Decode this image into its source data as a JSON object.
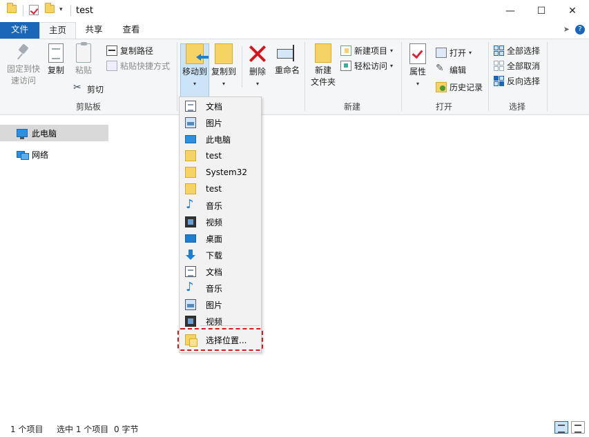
{
  "window": {
    "title": "test",
    "minimize_glyph": "—",
    "maximize_glyph": "☐",
    "close_glyph": "✕"
  },
  "tabs": [
    {
      "label": "文件"
    },
    {
      "label": "主页"
    },
    {
      "label": "共享"
    },
    {
      "label": "查看"
    }
  ],
  "ribbon": {
    "clipboard": {
      "pin_label_1": "固定到快",
      "pin_label_2": "速访问",
      "copy_label": "复制",
      "paste_label": "粘贴",
      "copy_path": "复制路径",
      "paste_shortcut": "粘贴快捷方式",
      "cut": "剪切",
      "group": "剪贴板"
    },
    "organize": {
      "move_to": "移动到",
      "copy_to": "复制到",
      "delete": "删除",
      "rename": "重命名"
    },
    "new": {
      "new_item": "新建项目",
      "easy_access": "轻松访问",
      "new_folder_1": "新建",
      "new_folder_2": "文件夹",
      "group": "新建"
    },
    "open": {
      "properties": "属性",
      "open": "打开",
      "edit": "编辑",
      "history": "历史记录",
      "group": "打开"
    },
    "select": {
      "select_all": "全部选择",
      "select_none": "全部取消",
      "invert": "反向选择",
      "group": "选择"
    }
  },
  "nav": {
    "items": [
      {
        "label": "此电脑",
        "icon": "pc-icon",
        "selected": true
      },
      {
        "label": "网络",
        "icon": "network-icon",
        "selected": false
      }
    ]
  },
  "move_menu": {
    "items": [
      {
        "label": "文档",
        "icon": "documents-icon"
      },
      {
        "label": "图片",
        "icon": "pictures-icon"
      },
      {
        "label": "此电脑",
        "icon": "pc-icon"
      },
      {
        "label": "test",
        "icon": "folder-icon"
      },
      {
        "label": "System32",
        "icon": "folder-icon"
      },
      {
        "label": "test",
        "icon": "folder-icon"
      },
      {
        "label": "音乐",
        "icon": "music-icon"
      },
      {
        "label": "视频",
        "icon": "video-icon"
      },
      {
        "label": "桌面",
        "icon": "desktop-icon"
      },
      {
        "label": "下载",
        "icon": "download-icon"
      },
      {
        "label": "文档",
        "icon": "documents-icon"
      },
      {
        "label": "音乐",
        "icon": "music-icon"
      },
      {
        "label": "图片",
        "icon": "pictures-icon"
      },
      {
        "label": "视频",
        "icon": "video-icon"
      }
    ],
    "choose_location": "选择位置..."
  },
  "status": {
    "count": "1 个项目",
    "selected": "选中 1 个项目",
    "size": "0 字节"
  },
  "colors": {
    "accent": "#1a66b8",
    "highlight_border": "#d9161c",
    "selected_button": "#cce4f7"
  }
}
